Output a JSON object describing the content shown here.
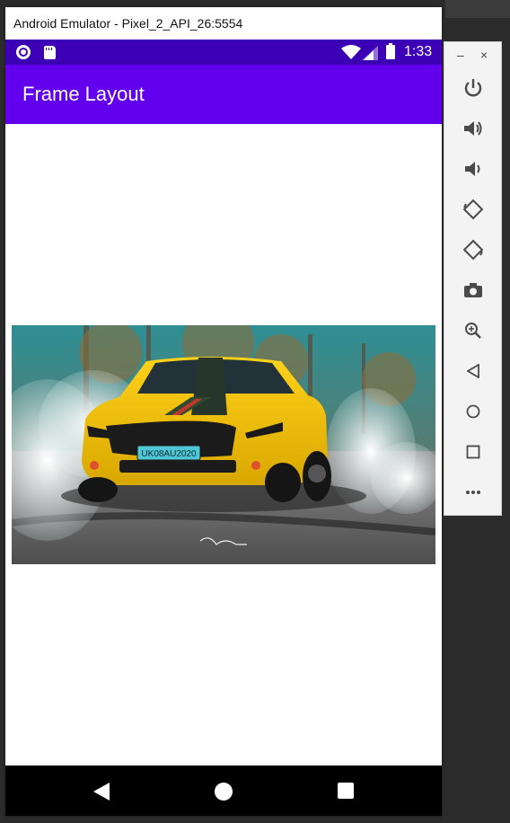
{
  "window": {
    "title": "Android Emulator - Pixel_2_API_26:5554"
  },
  "status_bar": {
    "time": "1:33",
    "color": "#3c00b5"
  },
  "app_bar": {
    "title": "Frame Layout",
    "color": "#6200ee"
  },
  "content": {
    "image": {
      "subject": "yellow sports car",
      "plate_text": "UK08AU2020"
    }
  },
  "nav_bar": {
    "buttons": [
      "back-icon",
      "home-icon",
      "recents-icon"
    ]
  },
  "side_panel": {
    "top": [
      "minimize-icon",
      "close-icon"
    ],
    "controls": [
      "power-icon",
      "volume-up-icon",
      "volume-down-icon",
      "rotate-left-icon",
      "rotate-right-icon",
      "camera-icon",
      "zoom-icon",
      "back-icon",
      "home-icon",
      "overview-icon",
      "more-icon"
    ]
  },
  "colors": {
    "desktop": "#2b2b2b",
    "car_yellow": "#f5c400",
    "plate": "#4fc7d6"
  }
}
